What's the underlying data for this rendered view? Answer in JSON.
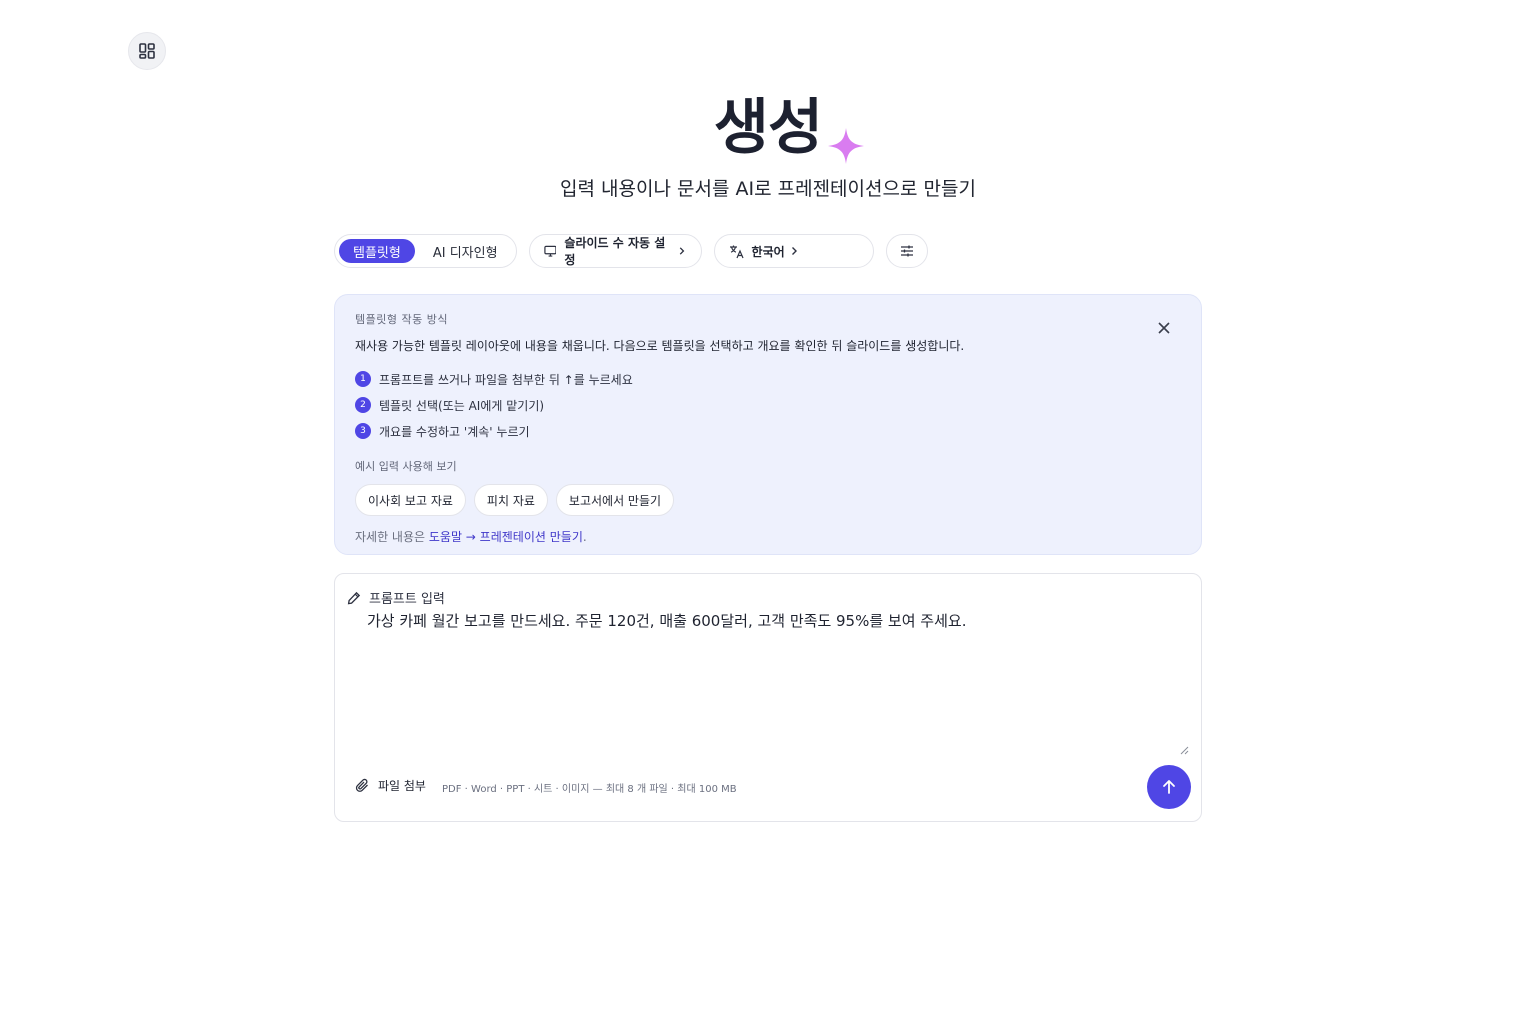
{
  "hero": {
    "title": "생성",
    "subtitle": "입력 내용이나 문서를 AI로 프레젠테이션으로 만들기"
  },
  "controls": {
    "mode_options": [
      "템플릿형",
      "AI 디자인형"
    ],
    "selected_mode": "템플릿형",
    "slides_label": "슬라이드 수 자동 설정",
    "language_label": "한국어"
  },
  "info": {
    "heading": "템플릿형 작동 방식",
    "description": "재사용 가능한 템플릿 레이아웃에 내용을 채웁니다. 다음으로 템플릿을 선택하고 개요를 확인한 뒤 슬라이드를 생성합니다.",
    "steps": [
      {
        "num": "1",
        "text": "프롬프트를 쓰거나 파일을 첨부한 뒤 ↑를 누르세요"
      },
      {
        "num": "2",
        "text": "템플릿 선택(또는 AI에게 맡기기)"
      },
      {
        "num": "3",
        "text": "개요를 수정하고 '계속' 누르기"
      }
    ],
    "example_label": "예시 입력 사용해 보기",
    "examples": [
      "이사회 보고 자료",
      "피치 자료",
      "보고서에서 만들기"
    ],
    "help_prefix": "자세한 내용은 ",
    "help_link": "도움말 → 프레젠테이션 만들기",
    "help_suffix": "."
  },
  "prompt": {
    "label": "프롬프트 입력",
    "value": "가상 카페 월간 보고를 만드세요. 주문 120건, 매출 600달러, 고객 만족도 95%를 보여 주세요.",
    "attach_label": "파일 첨부",
    "formats": "PDF · Word · PPT · 시트 · 이미지 — 최대 8 개 파일 · 최대 100 MB"
  },
  "colors": {
    "accent": "#4f46e5",
    "info_bg": "#eef1fd",
    "sparkle": "#d97cf0"
  },
  "icons": [
    "layout-grid-icon",
    "sparkle-icon",
    "monitor-icon",
    "chevron-right-icon",
    "translate-icon",
    "sliders-icon",
    "close-icon",
    "pencil-icon",
    "resize-grip-icon",
    "paperclip-icon",
    "arrow-up-icon"
  ]
}
